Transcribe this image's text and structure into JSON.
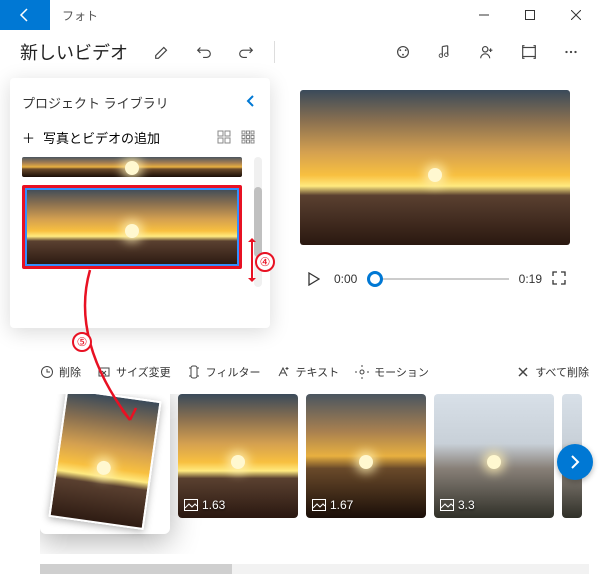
{
  "titlebar": {
    "app_name": "フォト"
  },
  "toolbar": {
    "new_video": "新しいビデオ"
  },
  "library": {
    "title": "プロジェクト ライブラリ",
    "add_label": "写真とビデオの追加"
  },
  "player": {
    "current": "0:00",
    "duration": "0:19"
  },
  "edit": {
    "trim": "削除",
    "resize": "サイズ変更",
    "filter": "フィルター",
    "text": "テキスト",
    "motion": "モーション",
    "delete_all": "すべて削除"
  },
  "clips": [
    {
      "duration": "1.63"
    },
    {
      "duration": "1.67"
    },
    {
      "duration": "3.3"
    }
  ],
  "annotations": {
    "n4": "④",
    "n5": "⑤"
  }
}
